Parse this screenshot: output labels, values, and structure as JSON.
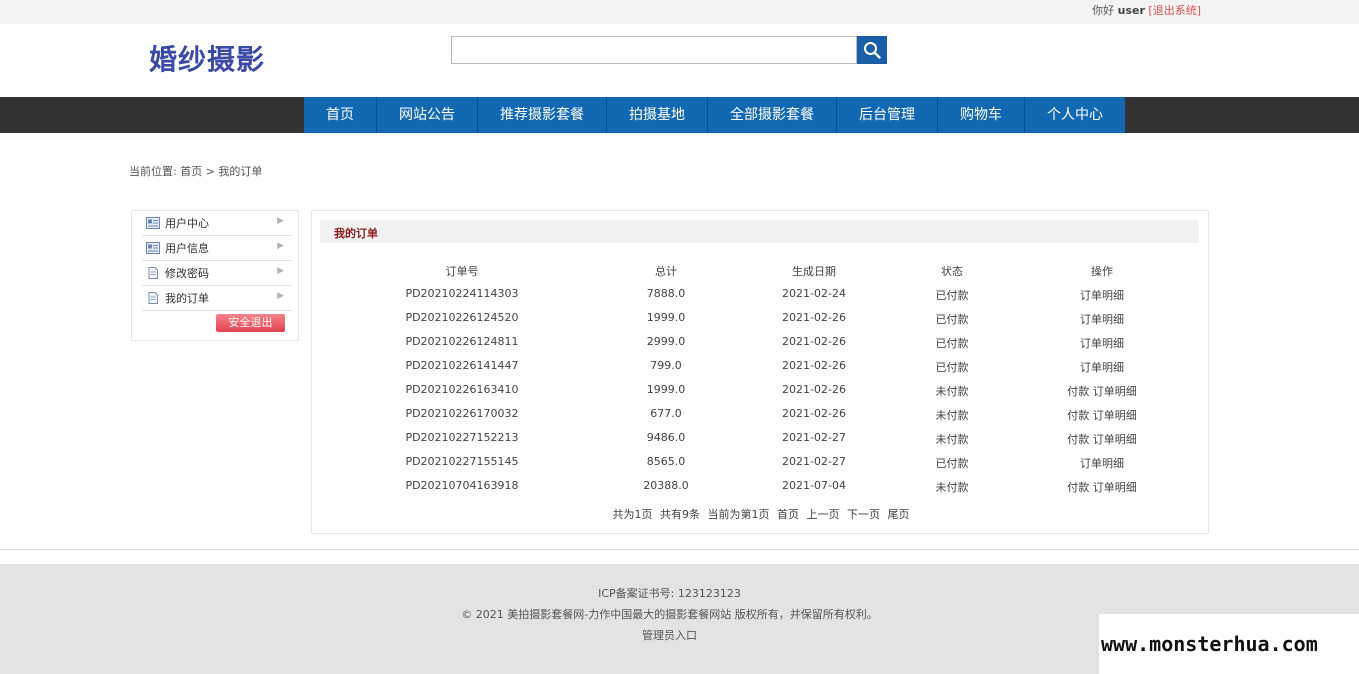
{
  "topbar": {
    "greeting": "你好",
    "username": "user",
    "logout": "[退出系统]"
  },
  "header": {
    "logo": "婚纱摄影",
    "search_placeholder": ""
  },
  "nav": [
    "首页",
    "网站公告",
    "推荐摄影套餐",
    "拍摄基地",
    "全部摄影套餐",
    "后台管理",
    "购物车",
    "个人中心"
  ],
  "breadcrumb": "当前位置: 首页 > 我的订单",
  "sidebar": {
    "items": [
      "用户中心",
      "用户信息",
      "修改密码",
      "我的订单"
    ],
    "exit": "安全退出"
  },
  "orders": {
    "title": "我的订单",
    "headers": [
      "订单号",
      "总计",
      "生成日期",
      "状态",
      "操作"
    ],
    "rows": [
      {
        "id": "PD20210224114303",
        "total": "7888.0",
        "date": "2021-02-24",
        "status": "已付款",
        "pay": "",
        "detail": "订单明细"
      },
      {
        "id": "PD20210226124520",
        "total": "1999.0",
        "date": "2021-02-26",
        "status": "已付款",
        "pay": "",
        "detail": "订单明细"
      },
      {
        "id": "PD20210226124811",
        "total": "2999.0",
        "date": "2021-02-26",
        "status": "已付款",
        "pay": "",
        "detail": "订单明细"
      },
      {
        "id": "PD20210226141447",
        "total": "799.0",
        "date": "2021-02-26",
        "status": "已付款",
        "pay": "",
        "detail": "订单明细"
      },
      {
        "id": "PD20210226163410",
        "total": "1999.0",
        "date": "2021-02-26",
        "status": "未付款",
        "pay": "付款",
        "detail": "订单明细"
      },
      {
        "id": "PD20210226170032",
        "total": "677.0",
        "date": "2021-02-26",
        "status": "未付款",
        "pay": "付款",
        "detail": "订单明细"
      },
      {
        "id": "PD20210227152213",
        "total": "9486.0",
        "date": "2021-02-27",
        "status": "未付款",
        "pay": "付款",
        "detail": "订单明细"
      },
      {
        "id": "PD20210227155145",
        "total": "8565.0",
        "date": "2021-02-27",
        "status": "已付款",
        "pay": "",
        "detail": "订单明细"
      },
      {
        "id": "PD20210704163918",
        "total": "20388.0",
        "date": "2021-07-04",
        "status": "未付款",
        "pay": "付款",
        "detail": "订单明细"
      }
    ],
    "pager": {
      "pages": "共为1页",
      "count": "共有9条",
      "current": "当前为第1页",
      "first": "首页",
      "prev": "上一页",
      "next": "下一页",
      "last": "尾页"
    }
  },
  "footer": {
    "icp": "ICP备案证书号: 123123123",
    "copyright": "© 2021 美拍摄影套餐网-力作中国最大的摄影套餐网站 版权所有，并保留所有权利。",
    "admin": "管理员入口"
  },
  "watermark": "www.monsterhua.com"
}
